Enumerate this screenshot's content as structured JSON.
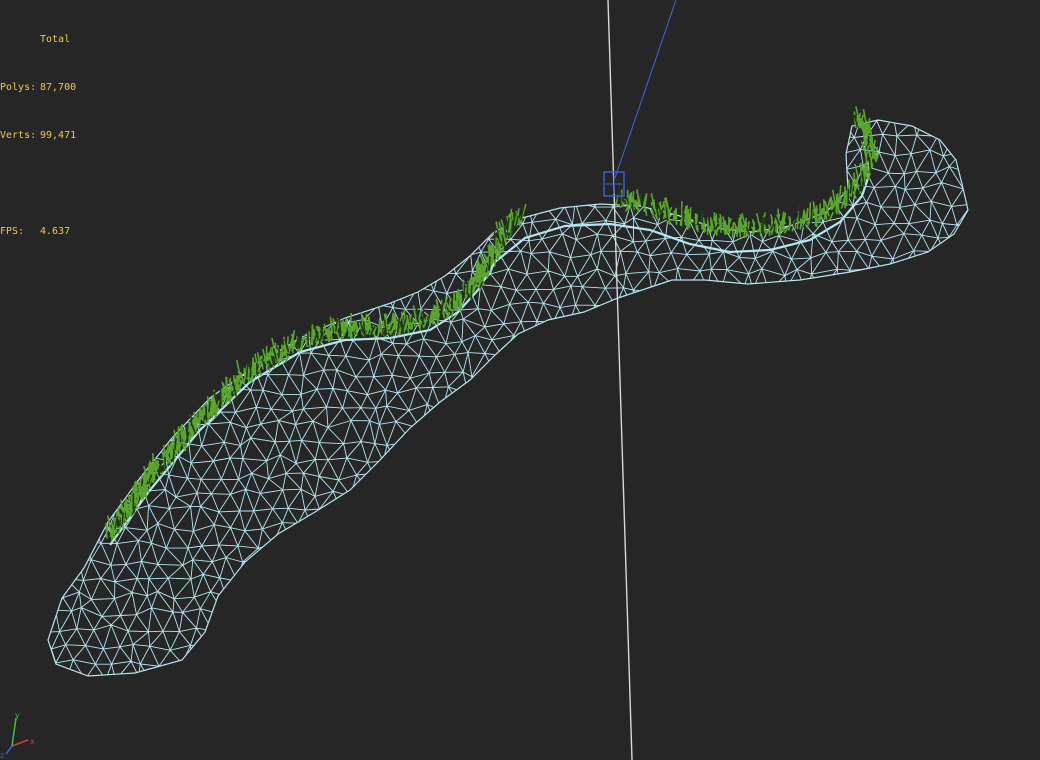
{
  "viewport": {
    "background_color": "#262626",
    "wireframe_color": "#b4e6f2",
    "grass_color": "#5aa62c",
    "grass_dark_color": "#1f3a12",
    "stats_text_color": "#f2c84a",
    "pivot_line_color": "#d8d8d8",
    "camera_target_line_color": "#3d62d4",
    "camera_icon_color": "#3d62d4"
  },
  "stats": {
    "title": "Total",
    "polys_label": "Polys:",
    "polys_value": "87,700",
    "verts_label": "Verts:",
    "verts_value": "99,471",
    "fps_label": "FPS:",
    "fps_value": "4.637"
  },
  "axis_gizmo": {
    "x_label": "x",
    "y_label": "y",
    "z_label": "z",
    "x_color": "#d63a3a",
    "y_color": "#3ac23a",
    "z_color": "#3a5ed6"
  }
}
